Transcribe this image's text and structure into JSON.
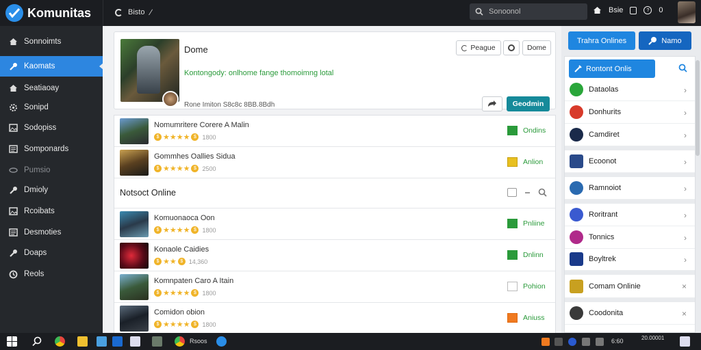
{
  "app": {
    "name": "Komunitas"
  },
  "topbar": {
    "nav_label": "Bisto",
    "search_placeholder": "Sonoonol",
    "right_label": "Bsie",
    "right_badge": "0"
  },
  "sidebar": {
    "items": [
      {
        "label": "Sonnoimts",
        "icon": "home-icon",
        "active": false
      },
      {
        "label": "Kaomats",
        "icon": "wrench-icon",
        "active": true
      },
      {
        "label": "Seatiaoay",
        "icon": "home-icon",
        "active": false
      },
      {
        "label": "Sonipd",
        "icon": "gear-icon",
        "active": false
      },
      {
        "label": "Sodopiss",
        "icon": "image-icon",
        "active": false
      },
      {
        "label": "Somponards",
        "icon": "list-icon",
        "active": false
      },
      {
        "label": "Pumsio",
        "icon": "dots-icon",
        "active": false
      },
      {
        "label": "Dmioly",
        "icon": "wrench-icon",
        "active": false
      },
      {
        "label": "Rcoibats",
        "icon": "image-icon",
        "active": false
      },
      {
        "label": "Desmoties",
        "icon": "list-icon",
        "active": false
      },
      {
        "label": "Doaps",
        "icon": "wrench-icon",
        "active": false
      },
      {
        "label": "Reols",
        "icon": "refresh-icon",
        "active": false
      }
    ]
  },
  "hero": {
    "title": "Dome",
    "description": "Kontongody: onlhome fange thomoimng lotal",
    "meta": "Rone Imiton S8c8c 8BB.8Bdh",
    "btn_engage": "Peague",
    "btn_done": "Dome",
    "btn_primary": "Geodmin"
  },
  "games_top": [
    {
      "title": "Nomumritere Corere A Malin",
      "stars": 4,
      "count": "1800",
      "status": "Ondins",
      "status_color": "#2a9a3a",
      "box_color": "#2a9a3a"
    },
    {
      "title": "Gommhes Oallies Sidua",
      "stars": 4,
      "count": "2500",
      "status": "Anlion",
      "status_color": "#2a9a3a",
      "box_color": "#e8c020"
    }
  ],
  "section": {
    "title": "Notsoct Online"
  },
  "games_bottom": [
    {
      "title": "Komuonaoca Oon",
      "stars": 4,
      "count": "1800",
      "status": "Pnliine",
      "status_color": "#2a9a3a",
      "box_color": "#2a9a3a"
    },
    {
      "title": "Konaole Caidies",
      "stars": 2,
      "count": "14,360",
      "status": "Dnlinn",
      "status_color": "#2a9a3a",
      "box_color": "#2a9a3a"
    },
    {
      "title": "Komnpaten Caro A Itain",
      "stars": 4,
      "count": "1800",
      "status": "Pohion",
      "status_color": "#2a9a3a",
      "box_color": "#ffffff"
    },
    {
      "title": "Comidon obion",
      "stars": 4,
      "count": "1800",
      "status": "Aniuss",
      "status_color": "#2a9a3a",
      "box_color": "#f07a20"
    }
  ],
  "right": {
    "btn_online": "Trahra Onlines",
    "btn_name": "Namo",
    "panel_title": "Rontont Onlis",
    "items": [
      {
        "label": "Dataolas",
        "color": "#2aa63a",
        "action": "chevron"
      },
      {
        "label": "Donhurits",
        "color": "#d83a2a",
        "action": "chevron"
      },
      {
        "label": "Camdiret",
        "color": "#1a2a4a",
        "action": "chevron"
      },
      {
        "label": "Ecoonot",
        "color": "#2a4a8a",
        "action": "chevron"
      },
      {
        "label": "Ramnoiot",
        "color": "#2a6ab0",
        "action": "chevron"
      },
      {
        "label": "Roritrant",
        "color": "#3a5ad0",
        "action": "chevron"
      },
      {
        "label": "Tonnics",
        "color": "#b02a8a",
        "action": "chevron"
      },
      {
        "label": "Boyltrek",
        "color": "#1a3a8a",
        "action": "chevron"
      },
      {
        "label": "Comam Onlinie",
        "color": "#c8a020",
        "action": "close"
      },
      {
        "label": "Coodonita",
        "color": "#3a3a3a",
        "action": "close"
      }
    ]
  },
  "taskbar": {
    "app_label": "Rsoos",
    "clock_time": "6:60",
    "clock_date": "20.00001"
  }
}
